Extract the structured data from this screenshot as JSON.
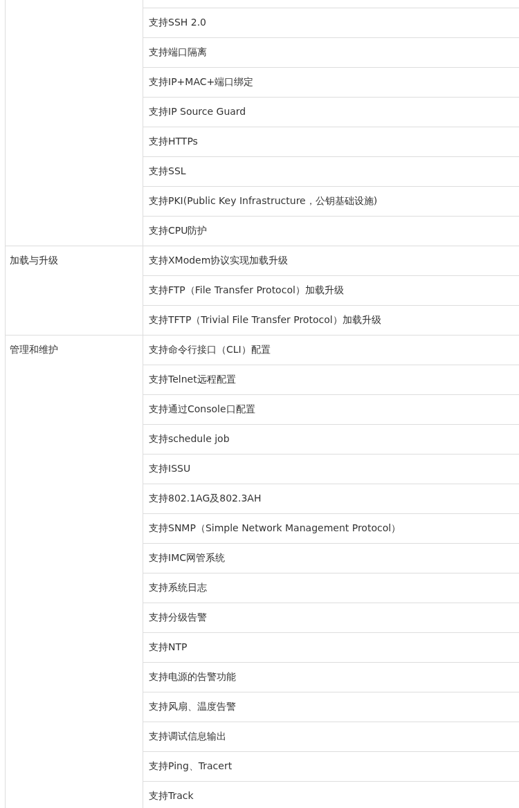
{
  "groups": [
    {
      "items": [
        "支持SSH 2.0",
        "支持端口隔离",
        "支持IP+MAC+端口绑定",
        "支持IP Source Guard",
        "支持HTTPs",
        "支持SSL",
        "支持PKI(Public Key Infrastructure，公钥基础设施)",
        "支持CPU防护"
      ]
    },
    {
      "category": "加载与升级",
      "items": [
        "支持XModem协议实现加载升级",
        "支持FTP（File Transfer Protocol）加载升级",
        "支持TFTP（Trivial File Transfer Protocol）加载升级"
      ]
    },
    {
      "category": "管理和维护",
      "items": [
        "支持命令行接口（CLI）配置",
        "支持Telnet远程配置",
        "支持通过Console口配置",
        "支持schedule job",
        "支持ISSU",
        "支持802.1AG及802.3AH",
        "支持SNMP（Simple Network Management Protocol）",
        "支持IMC网管系统",
        "支持系统日志",
        "支持分级告警",
        "支持NTP",
        "支持电源的告警功能",
        "支持风扇、温度告警",
        "支持调试信息输出",
        "支持Ping、Tracert",
        "支持Track"
      ]
    }
  ]
}
